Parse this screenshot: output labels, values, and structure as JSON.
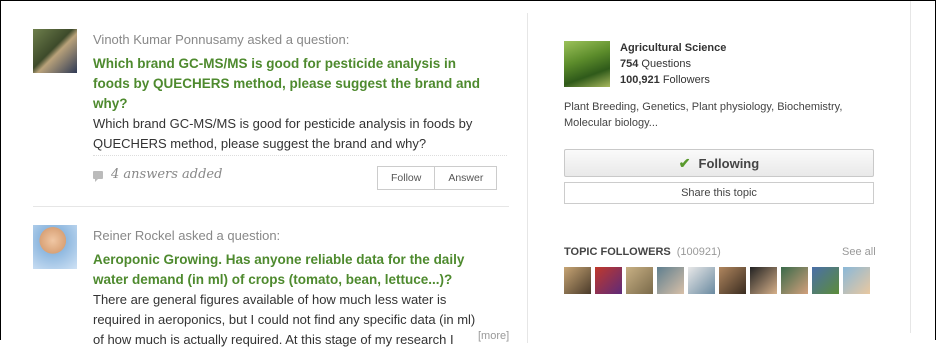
{
  "feed": {
    "questions": [
      {
        "asker_line": "Vinoth Kumar Ponnusamy asked a question:",
        "title": "Which brand GC-MS/MS is good for pesticide analysis in foods by QUECHERS method, please suggest the brand and why?",
        "body": "Which brand GC-MS/MS is good for pesticide analysis in foods by QUECHERS method, please suggest the brand and why?",
        "answers": "4 answers added",
        "follow_label": "Follow",
        "answer_label": "Answer"
      },
      {
        "asker_line": "Reiner Rockel asked a question:",
        "title": "Aeroponic Growing. Has anyone reliable data for the daily water demand (in ml) of crops (tomato, bean, lettuce...)?",
        "body": "There are general figures available of how much less water is required in aeroponics, but I could not find any specific data (in ml) of how much is actually required.  At this stage of my research I",
        "more": "[more]"
      }
    ]
  },
  "topic": {
    "name": "Agricultural Science",
    "questions_count": "754",
    "questions_label": "Questions",
    "followers_count": "100,921",
    "followers_label": "Followers",
    "description": "Plant Breeding, Genetics, Plant physiology, Biochemistry, Molecular biology...",
    "following_label": "Following",
    "share_label": "Share this topic",
    "topic_followers_label": "TOPIC FOLLOWERS",
    "topic_followers_count": "(100921)",
    "see_all": "See all"
  },
  "colors": {
    "accent_green": "#4e8a2e",
    "check_green": "#5a9a2e"
  },
  "icons": [
    "comment-bubble-icon",
    "checkmark-icon"
  ]
}
